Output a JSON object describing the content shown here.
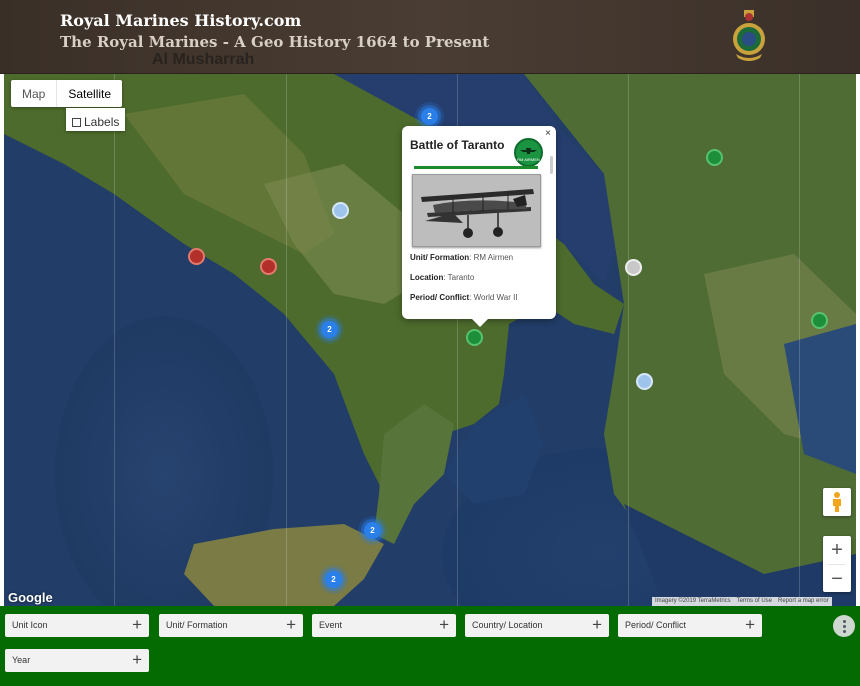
{
  "header": {
    "title": "Royal Marines History.com",
    "subtitle": "The Royal Marines - A Geo History 1664 to Present",
    "map_place_label": "Al Musharrah",
    "crest_icon": "royal-marines-crest-icon"
  },
  "map": {
    "type_buttons": {
      "map": "Map",
      "satellite": "Satellite"
    },
    "labels_label": "Labels",
    "google_logo": "Google",
    "attribution": {
      "imagery": "Imagery ©2019 TerraMetrics",
      "terms": "Terms of Use",
      "report": "Report a map error"
    },
    "zoom_in": "+",
    "zoom_out": "−",
    "cluster_labels": [
      "2",
      "2",
      "2",
      "2"
    ],
    "colors": {
      "cluster": "#2a7fe8",
      "event_red": "#b3302a",
      "event_green": "#1d8f3a",
      "event_lightblue": "#9ec4ec",
      "event_grey": "#c8c8c8"
    }
  },
  "info_window": {
    "close": "×",
    "title": "Battle of Taranto",
    "logo_text": "RM AIRMEN",
    "unit_label": "Unit/ Formation",
    "unit_value": "RM Airmen",
    "location_label": "Location",
    "location_value": "Taranto",
    "period_label": "Period/ Conflict",
    "period_value": "World War II"
  },
  "filters": {
    "chips": [
      {
        "label": "Unit Icon"
      },
      {
        "label": "Unit/ Formation"
      },
      {
        "label": "Event"
      },
      {
        "label": "Country/ Location"
      },
      {
        "label": "Period/ Conflict"
      },
      {
        "label": "Year"
      }
    ],
    "plus": "+",
    "background": "#036b02"
  }
}
